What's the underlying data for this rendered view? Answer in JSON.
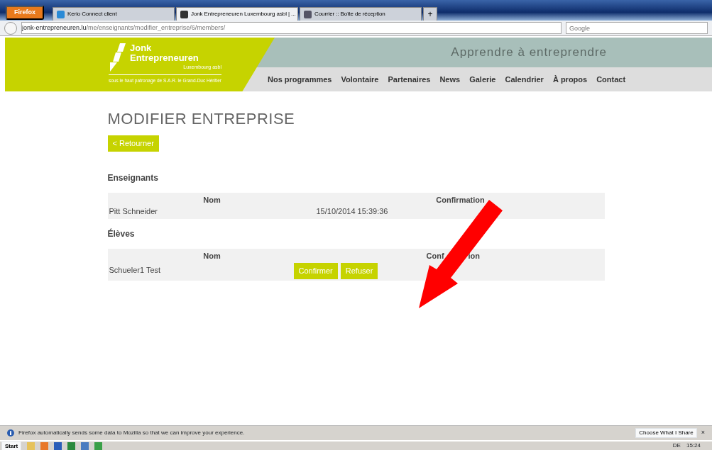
{
  "browser": {
    "menu_button": "Firefox",
    "tabs": [
      {
        "title": "Kerio Connect client",
        "selected": false
      },
      {
        "title": "Jonk Entrepreneuren Luxembourg asbl | ...",
        "selected": true
      },
      {
        "title": "Courrier :: Boîte de réception",
        "selected": false
      }
    ],
    "new_tab": "+",
    "url_host": "jonk-entrepreneuren.lu",
    "url_path": "/me/enseignants/modifier_entreprise/6/members/",
    "search_placeholder": "Google"
  },
  "site": {
    "logo_title": [
      "Jonk",
      "Entrepreneuren"
    ],
    "logo_subtitle": "Luxembourg asbl",
    "patronage": "sous le haut patronage de S.A.R. le Grand-Duc Héritier",
    "tagline": "Apprendre à entreprendre",
    "nav": [
      "Nos programmes",
      "Volontaire",
      "Partenaires",
      "News",
      "Galerie",
      "Calendrier",
      "À propos",
      "Contact"
    ]
  },
  "page": {
    "title": "MODIFIER ENTREPRISE",
    "back_button": "< Retourner",
    "sections": [
      {
        "heading": "Enseignants",
        "columns": [
          {
            "label": "Nom"
          },
          {
            "label": "Confirmation"
          }
        ],
        "rows": [
          {
            "kind": "date",
            "name": "Pitt Schneider",
            "confirmation": "15/10/2014 15:39:36"
          }
        ]
      },
      {
        "heading": "Élèves",
        "columns": [
          {
            "label": "Nom"
          },
          {
            "label_parts": [
              "Conf",
              "ion"
            ]
          }
        ],
        "rows": [
          {
            "kind": "actions",
            "name": "Schueler1 Test",
            "actions": [
              "Confirmer",
              "Refuser"
            ]
          }
        ]
      }
    ]
  },
  "notification": {
    "text": "Firefox automatically sends some data to Mozilla so that we can improve your experience.",
    "button": "Choose What I Share",
    "close": "×"
  },
  "taskbar": {
    "start": "Start",
    "language": "DE",
    "clock": "15:24"
  }
}
